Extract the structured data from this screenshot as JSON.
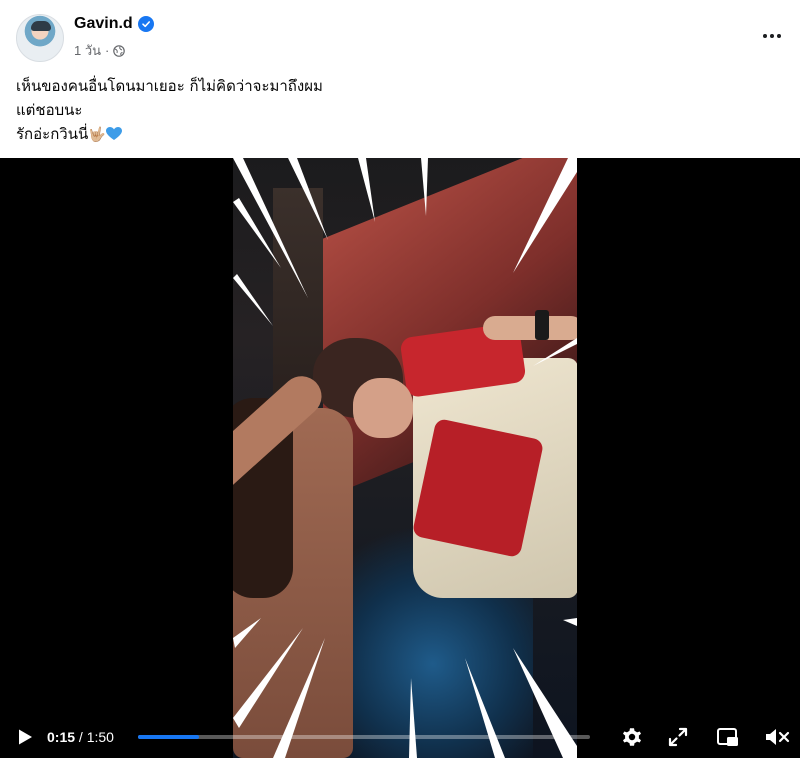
{
  "post": {
    "author": "Gavin.d",
    "verified": true,
    "time": "1 วัน",
    "dot": "·",
    "privacy_icon": "globe-icon",
    "menu_icon": "more-horizontal-icon"
  },
  "caption": {
    "line1": "เห็นของคนอื่นโดนมาเยอะ ก็ไม่คิดว่าจะมาถึงผม",
    "line2": "แต่ชอบนะ",
    "line3": "รักอ่ะกวินนี่",
    "emoji_hand": "🤟🏼",
    "emoji_heart": "blue-heart-icon"
  },
  "video": {
    "current_time": "0:15",
    "separator": "/",
    "duration": "1:50",
    "progress_fraction": 0.136,
    "controls": [
      "play-icon",
      "settings-gear-icon",
      "fullscreen-icon",
      "picture-in-picture-icon",
      "volume-muted-icon"
    ]
  },
  "colors": {
    "accent": "#1877f2",
    "text": "#050505",
    "secondary_text": "#65676b",
    "video_bg": "#000000"
  }
}
